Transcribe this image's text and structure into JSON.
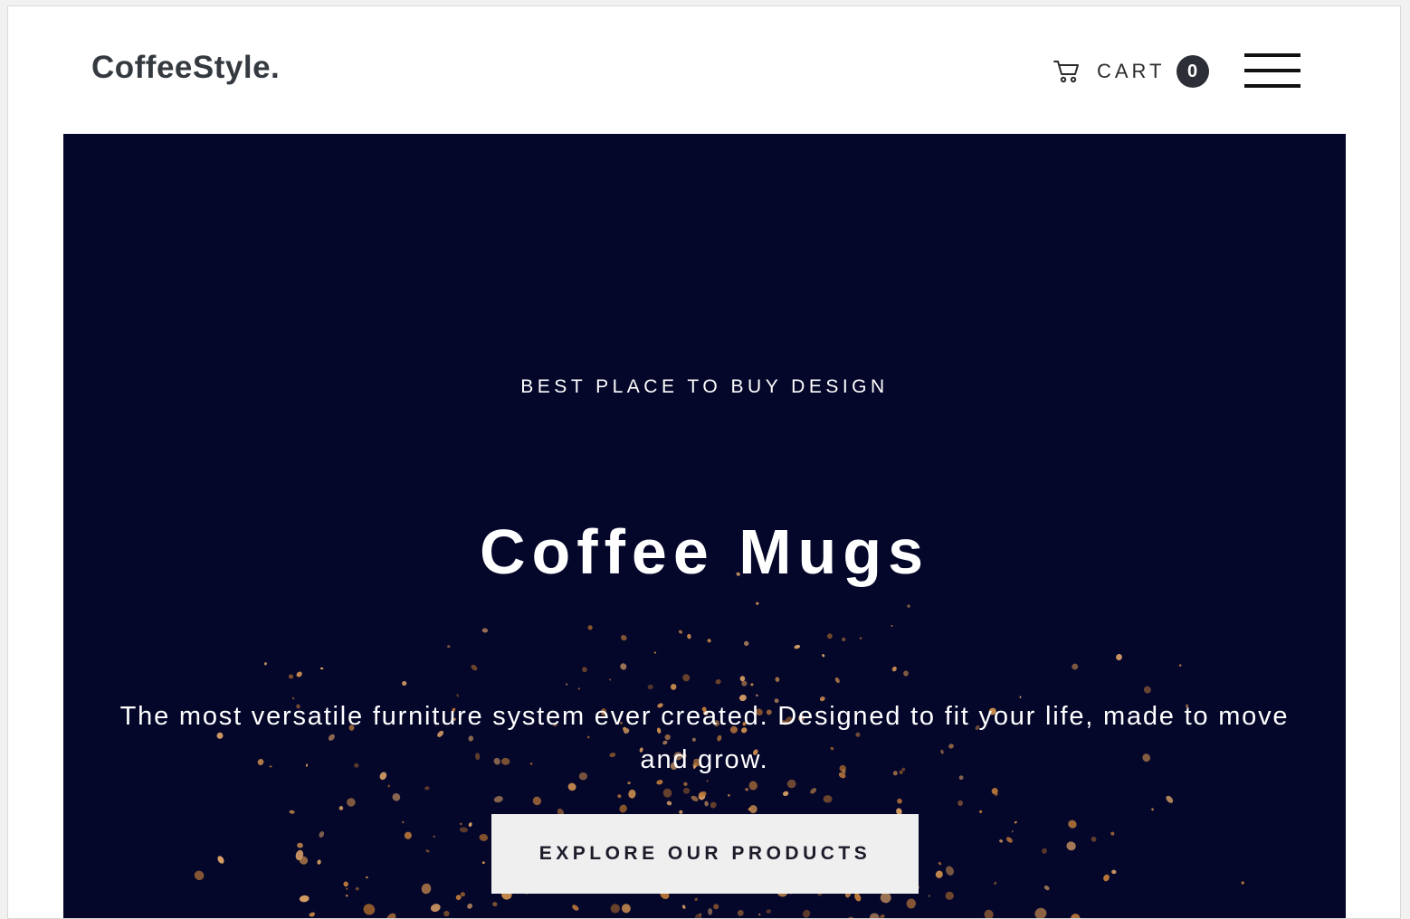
{
  "header": {
    "logo": "CoffeeStyle.",
    "cart_label": "CART",
    "cart_count": "0",
    "cart_icon": "shopping-cart-icon",
    "menu_icon": "hamburger-menu-icon"
  },
  "hero": {
    "eyebrow": "BEST PLACE TO BUY DESIGN",
    "title": "Coffee Mugs",
    "subtitle": "The most versatile furniture system ever created. Designed to fit your life, made to move and grow.",
    "cta_label": "EXPLORE OUR PRODUCTS",
    "background_color": "#04062a",
    "particle_color": "#c98c4e"
  }
}
